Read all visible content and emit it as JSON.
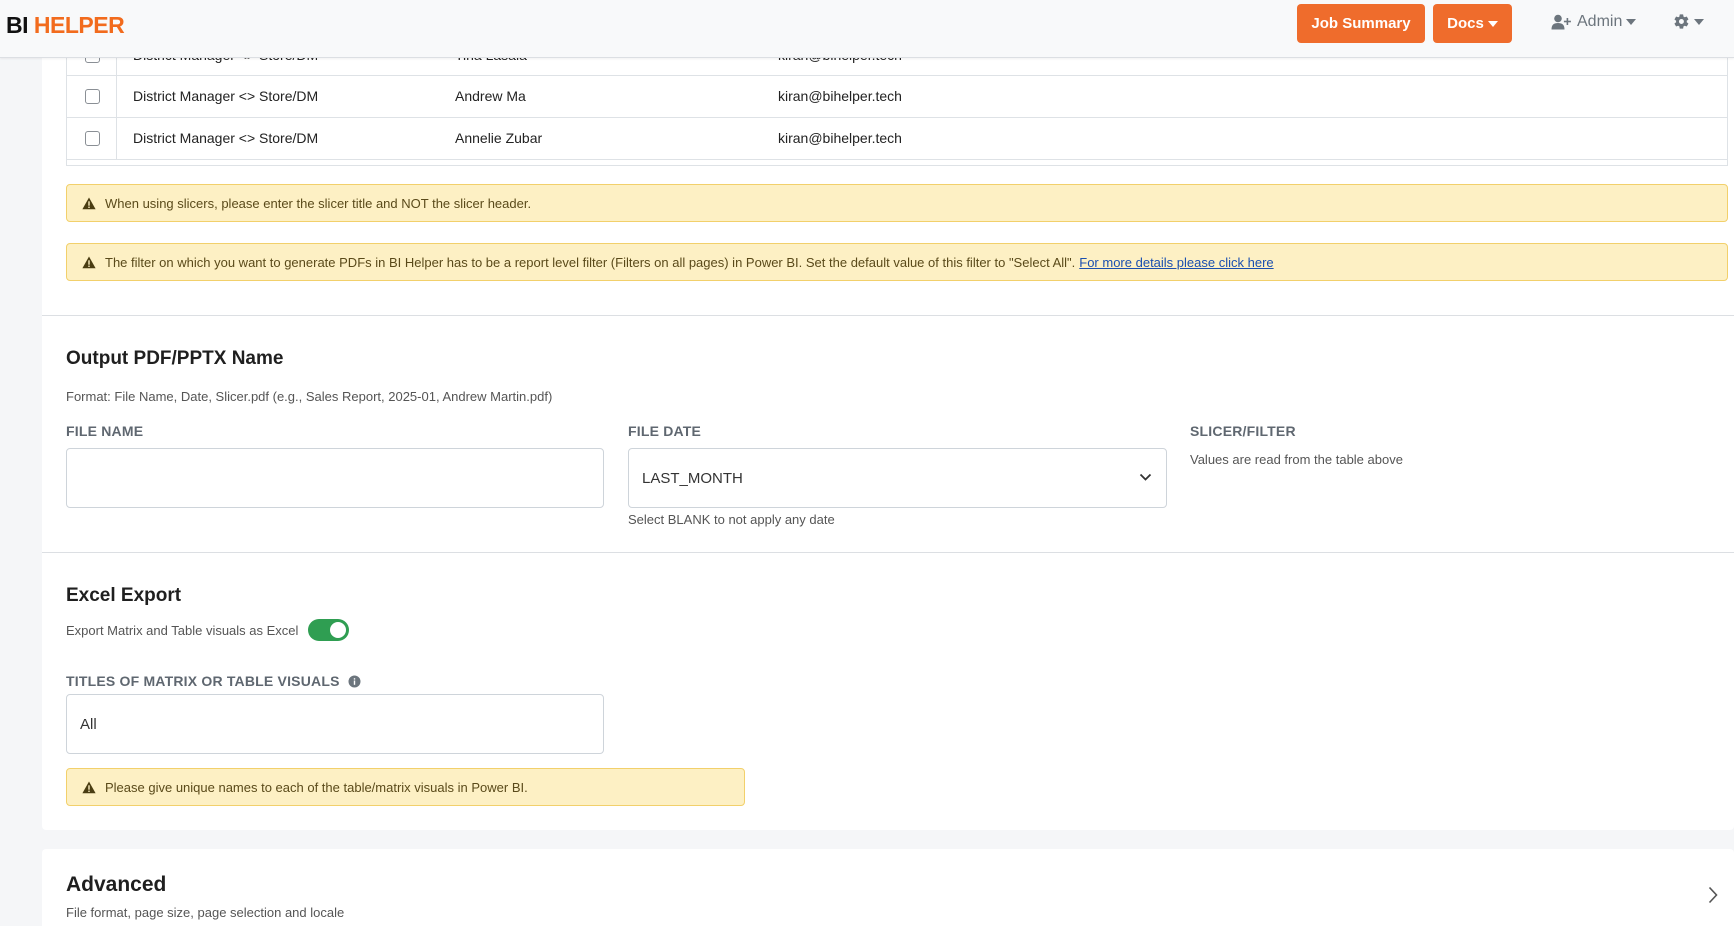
{
  "header": {
    "logo_bi": "BI",
    "logo_helper": "HELPER",
    "job_summary_label": "Job Summary",
    "docs_label": "Docs",
    "user_label": "Admin"
  },
  "table": {
    "rows": [
      {
        "role": "District Manager <> Store/DM",
        "name": "Tina Lasala",
        "email": "kiran@bihelper.tech"
      },
      {
        "role": "District Manager <> Store/DM",
        "name": "Andrew Ma",
        "email": "kiran@bihelper.tech"
      },
      {
        "role": "District Manager <> Store/DM",
        "name": "Annelie Zubar",
        "email": "kiran@bihelper.tech"
      }
    ]
  },
  "alerts": {
    "slicer": "When using slicers, please enter the slicer title and NOT the slicer header.",
    "filter": "The filter on which you want to generate PDFs in BI Helper has to be a report level filter (Filters on all pages) in Power BI. Set the default value of this filter to \"Select All\".",
    "filter_link": "For more details please click here",
    "unique_names": "Please give unique names to each of the table/matrix visuals in Power BI."
  },
  "output": {
    "title": "Output PDF/PPTX Name",
    "format_hint": "Format: File Name, Date, Slicer.pdf (e.g., Sales Report, 2025-01, Andrew Martin.pdf)",
    "file_name_label": "FILE NAME",
    "file_name_value": "",
    "file_date_label": "FILE DATE",
    "file_date_value": "LAST_MONTH",
    "file_date_help": "Select BLANK to not apply any date",
    "slicer_label": "SLICER/FILTER",
    "slicer_help": "Values are read from the table above"
  },
  "excel": {
    "title": "Excel Export",
    "toggle_label": "Export Matrix and Table visuals as Excel",
    "toggle_on": true,
    "titles_label": "TITLES OF MATRIX OR TABLE VISUALS",
    "titles_value": "All"
  },
  "advanced": {
    "title": "Advanced",
    "subtitle": "File format, page size, page selection and locale"
  },
  "colors": {
    "accent": "#ef6c2c",
    "toggle_on": "#2f9e52",
    "warning_bg": "#fdf0c4"
  }
}
